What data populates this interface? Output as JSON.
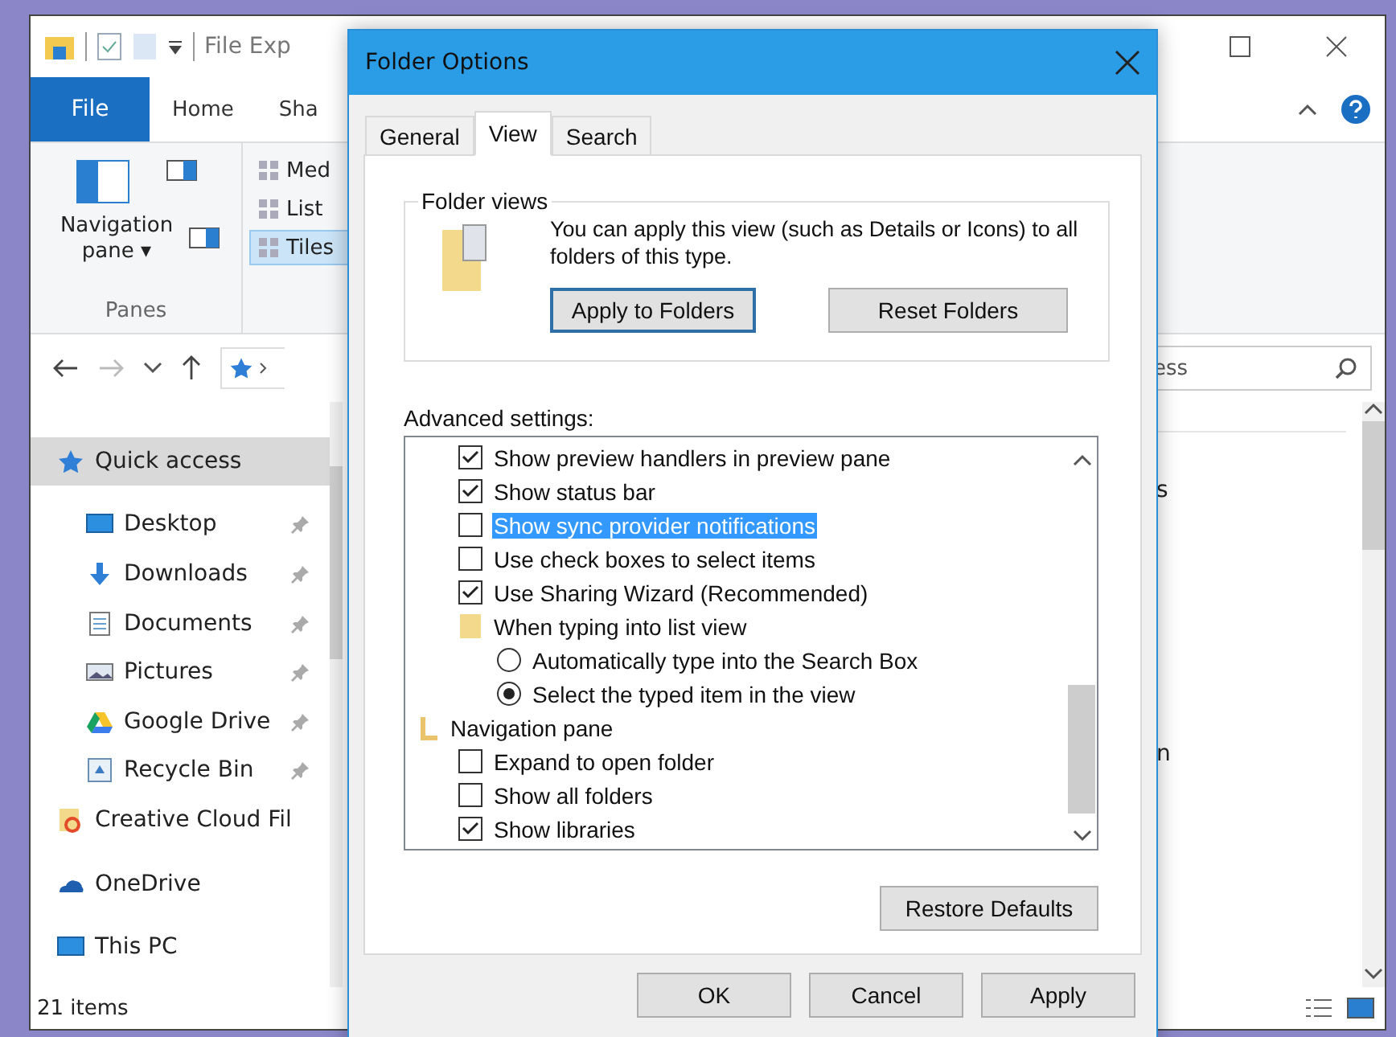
{
  "explorer": {
    "title": "File Exp",
    "ribbon_tabs": [
      {
        "label": "File",
        "selected": true
      },
      {
        "label": "Home",
        "selected": false
      },
      {
        "label": "Sha",
        "selected": false
      }
    ],
    "panes_group": {
      "navigation_pane": "Navigation pane",
      "caret": "▾",
      "label": "Panes"
    },
    "layouts": [
      {
        "label": "Med",
        "selected": false
      },
      {
        "label": "List",
        "selected": false
      },
      {
        "label": "Tiles",
        "selected": true
      }
    ],
    "search": {
      "value": "ess"
    },
    "sidebar": [
      {
        "label": "Quick access",
        "selected": true,
        "children": [
          {
            "label": "Desktop",
            "pinned": true
          },
          {
            "label": "Downloads",
            "pinned": true
          },
          {
            "label": "Documents",
            "pinned": true
          },
          {
            "label": "Pictures",
            "pinned": true
          },
          {
            "label": "Google Drive",
            "pinned": true
          },
          {
            "label": "Recycle Bin",
            "pinned": true
          }
        ]
      },
      {
        "label": "Creative Cloud Fil",
        "selected": false
      },
      {
        "label": "OneDrive",
        "selected": false
      },
      {
        "label": "This PC",
        "selected": false
      }
    ],
    "content": [
      "s",
      "n"
    ],
    "status_bar": "21 items"
  },
  "dialog": {
    "title": "Folder Options",
    "tabs": [
      {
        "label": "General",
        "selected": false
      },
      {
        "label": "View",
        "selected": true
      },
      {
        "label": "Search",
        "selected": false
      }
    ],
    "folder_views": {
      "legend": "Folder views",
      "text": "You can apply this view (such as Details or Icons) to all folders of this type.",
      "buttons": [
        {
          "label": "Apply to Folders",
          "focused": true
        },
        {
          "label": "Reset Folders",
          "focused": false
        }
      ]
    },
    "advanced_label": "Advanced settings:",
    "advanced": [
      {
        "kind": "continued",
        "children": [
          {
            "kind": "checkbox",
            "label": "Show preview handlers in preview pane",
            "checked": true,
            "highlighted": false
          },
          {
            "kind": "checkbox",
            "label": "Show status bar",
            "checked": true,
            "highlighted": false
          },
          {
            "kind": "checkbox",
            "label": "Show sync provider notifications",
            "checked": false,
            "highlighted": true
          },
          {
            "kind": "checkbox",
            "label": "Use check boxes to select items",
            "checked": false,
            "highlighted": false
          },
          {
            "kind": "checkbox",
            "label": "Use Sharing Wizard (Recommended)",
            "checked": true,
            "highlighted": false
          },
          {
            "kind": "folder",
            "label": "When typing into list view",
            "children": [
              {
                "kind": "radio",
                "label": "Automatically type into the Search Box",
                "selected": false
              },
              {
                "kind": "radio",
                "label": "Select the typed item in the view",
                "selected": true
              }
            ]
          }
        ]
      },
      {
        "kind": "section",
        "label": "Navigation pane",
        "children": [
          {
            "kind": "checkbox",
            "label": "Expand to open folder",
            "checked": false,
            "highlighted": false
          },
          {
            "kind": "checkbox",
            "label": "Show all folders",
            "checked": false,
            "highlighted": false
          },
          {
            "kind": "checkbox",
            "label": "Show libraries",
            "checked": true,
            "highlighted": false
          }
        ]
      }
    ],
    "restore_button": "Restore Defaults",
    "buttons": [
      "OK",
      "Cancel",
      "Apply"
    ]
  }
}
